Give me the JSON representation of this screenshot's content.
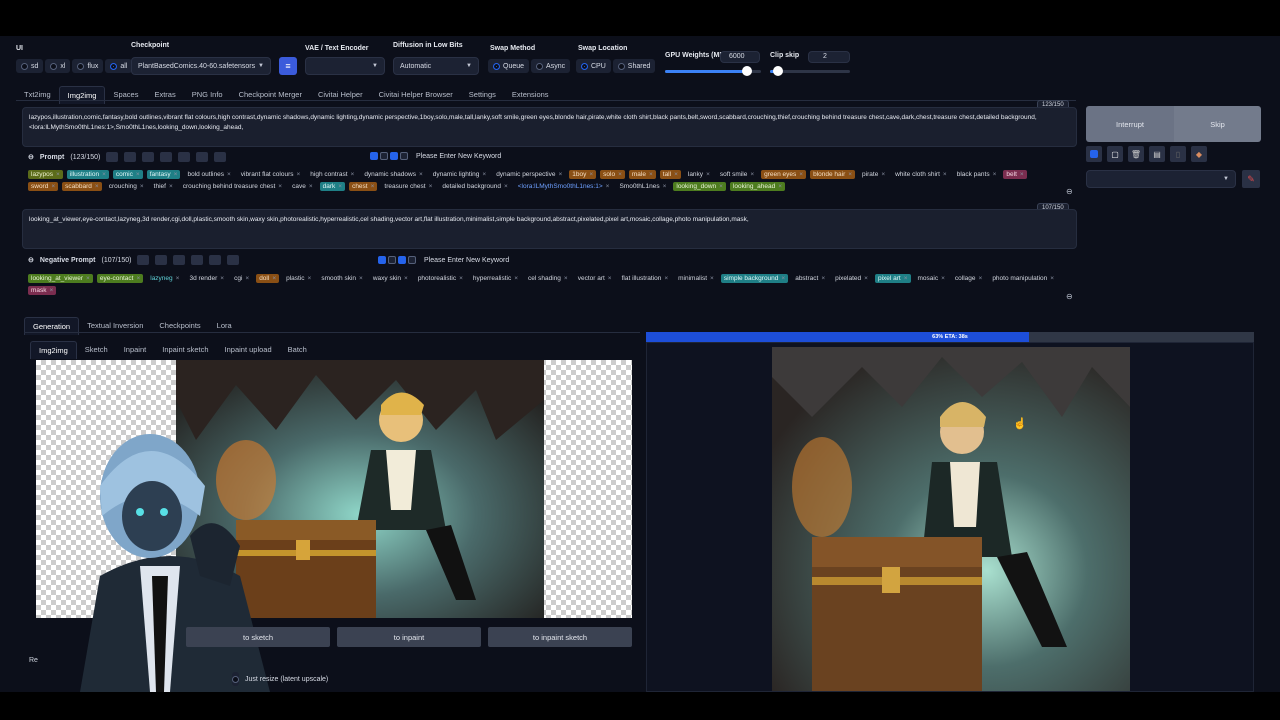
{
  "top": {
    "ui_label": "UI",
    "ui_options": [
      "sd",
      "xl",
      "flux",
      "all"
    ],
    "ui_selected": "all",
    "checkpoint_label": "Checkpoint",
    "checkpoint_value": "PlantBasedComics.40-60.safetensors",
    "vae_label": "VAE / Text Encoder",
    "vae_value": "",
    "diffusion_label": "Diffusion in Low Bits",
    "diffusion_value": "Automatic",
    "swap_method_label": "Swap Method",
    "swap_method_options": [
      "Queue",
      "Async"
    ],
    "swap_method_selected": "Queue",
    "swap_location_label": "Swap Location",
    "swap_location_options": [
      "CPU",
      "Shared"
    ],
    "swap_location_selected": "CPU",
    "gpu_weights_label": "GPU Weights (MB)",
    "gpu_weights_value": "6000",
    "gpu_weights_fraction": 0.85,
    "clip_skip_label": "Clip skip",
    "clip_skip_value": "2",
    "clip_skip_fraction": 0.1
  },
  "main_tabs": [
    "Txt2img",
    "Img2img",
    "Spaces",
    "Extras",
    "PNG Info",
    "Checkpoint Merger",
    "Civitai Helper",
    "Civitai Helper Browser",
    "Settings",
    "Extensions"
  ],
  "main_tab_active": "Img2img",
  "prompt": {
    "counter": "123/150",
    "text": "lazypos,illustration,comic,fantasy,bold outlines,vibrant flat colours,high contrast,dynamic shadows,dynamic lighting,dynamic perspective,1boy,solo,male,tall,lanky,soft smile,green eyes,blonde hair,pirate,white cloth shirt,black pants,belt,sword,scabbard,crouching,thief,crouching behind treasure chest,cave,dark,chest,treasure chest,detailed background,<lora:lLMythSmo0thL1nes:1>,Smo0thL1nes,looking_down,looking_ahead,",
    "header_label": "Prompt",
    "header_count": "(123/150)",
    "keyword_placeholder": "Please Enter New Keyword",
    "tags": [
      {
        "t": "lazypos",
        "c": "olive"
      },
      {
        "t": "illustration",
        "c": "teal"
      },
      {
        "t": "comic",
        "c": "teal"
      },
      {
        "t": "fantasy",
        "c": "teal"
      },
      {
        "t": "bold outlines",
        "c": ""
      },
      {
        "t": "vibrant flat colours",
        "c": ""
      },
      {
        "t": "high contrast",
        "c": ""
      },
      {
        "t": "dynamic shadows",
        "c": ""
      },
      {
        "t": "dynamic lighting",
        "c": ""
      },
      {
        "t": "dynamic perspective",
        "c": ""
      },
      {
        "t": "1boy",
        "c": "orange"
      },
      {
        "t": "solo",
        "c": "orange"
      },
      {
        "t": "male",
        "c": "orange"
      },
      {
        "t": "tall",
        "c": "orange"
      },
      {
        "t": "lanky",
        "c": ""
      },
      {
        "t": "soft smile",
        "c": ""
      },
      {
        "t": "green eyes",
        "c": "orange"
      },
      {
        "t": "blonde hair",
        "c": "orange"
      },
      {
        "t": "pirate",
        "c": ""
      },
      {
        "t": "white cloth shirt",
        "c": ""
      },
      {
        "t": "black pants",
        "c": ""
      },
      {
        "t": "belt",
        "c": "pink"
      },
      {
        "t": "sword",
        "c": "orange"
      },
      {
        "t": "scabbard",
        "c": "orange"
      },
      {
        "t": "crouching",
        "c": ""
      },
      {
        "t": "thief",
        "c": ""
      },
      {
        "t": "crouching behind treasure chest",
        "c": ""
      },
      {
        "t": "cave",
        "c": ""
      },
      {
        "t": "dark",
        "c": "teal"
      },
      {
        "t": "chest",
        "c": "orange"
      },
      {
        "t": "treasure chest",
        "c": ""
      },
      {
        "t": "detailed background",
        "c": ""
      },
      {
        "t": "<lora:lLMythSmo0thL1nes:1>",
        "c": "blue"
      },
      {
        "t": "Smo0thL1nes",
        "c": ""
      },
      {
        "t": "looking_down",
        "c": "green"
      },
      {
        "t": "looking_ahead",
        "c": "green"
      }
    ]
  },
  "negative": {
    "counter": "107/150",
    "text": "looking_at_viewer,eye-contact,lazyneg,3d render,cgi,doll,plastic,smooth skin,waxy skin,photorealistic,hyperrealistic,cel shading,vector art,flat illustration,minimalist,simple background,abstract,pixelated,pixel art,mosaic,collage,photo manipulation,mask,",
    "header_label": "Negative Prompt",
    "header_count": "(107/150)",
    "keyword_placeholder": "Please Enter New Keyword",
    "tags": [
      {
        "t": "looking_at_viewer",
        "c": "green"
      },
      {
        "t": "eye-contact",
        "c": "green"
      },
      {
        "t": "lazyneg",
        "c": "teal2"
      },
      {
        "t": "3d render",
        "c": ""
      },
      {
        "t": "cgi",
        "c": ""
      },
      {
        "t": "doll",
        "c": "orange"
      },
      {
        "t": "plastic",
        "c": ""
      },
      {
        "t": "smooth skin",
        "c": ""
      },
      {
        "t": "waxy skin",
        "c": ""
      },
      {
        "t": "photorealistic",
        "c": ""
      },
      {
        "t": "hyperrealistic",
        "c": ""
      },
      {
        "t": "cel shading",
        "c": ""
      },
      {
        "t": "vector art",
        "c": ""
      },
      {
        "t": "flat illustration",
        "c": ""
      },
      {
        "t": "minimalist",
        "c": ""
      },
      {
        "t": "simple background",
        "c": "teal"
      },
      {
        "t": "abstract",
        "c": ""
      },
      {
        "t": "pixelated",
        "c": ""
      },
      {
        "t": "pixel art",
        "c": "teal"
      },
      {
        "t": "mosaic",
        "c": ""
      },
      {
        "t": "collage",
        "c": ""
      },
      {
        "t": "photo manipulation",
        "c": ""
      },
      {
        "t": "mask",
        "c": "pink"
      }
    ]
  },
  "actions": {
    "interrupt": "Interrupt",
    "skip": "Skip"
  },
  "sub_tabs": [
    "Generation",
    "Textual Inversion",
    "Checkpoints",
    "Lora"
  ],
  "sub_tab_active": "Generation",
  "img_tabs": [
    "Img2img",
    "Sketch",
    "Inpaint",
    "Inpaint sketch",
    "Inpaint upload",
    "Batch"
  ],
  "img_tab_active": "Img2img",
  "send_buttons": [
    "to sketch",
    "to inpaint",
    "to inpaint sketch"
  ],
  "resize_label": "Re",
  "resize_option": "Just resize (latent upscale)",
  "progress": {
    "text": "63% ETA: 38s",
    "fraction": 0.63
  },
  "colors": {
    "accent": "#2563eb",
    "progress": "#1d4ed8",
    "tag_green": "#4d7c1f",
    "tag_teal": "#1f7f86",
    "tag_orange": "#8a4f14",
    "tag_pink": "#7b2d4f"
  }
}
